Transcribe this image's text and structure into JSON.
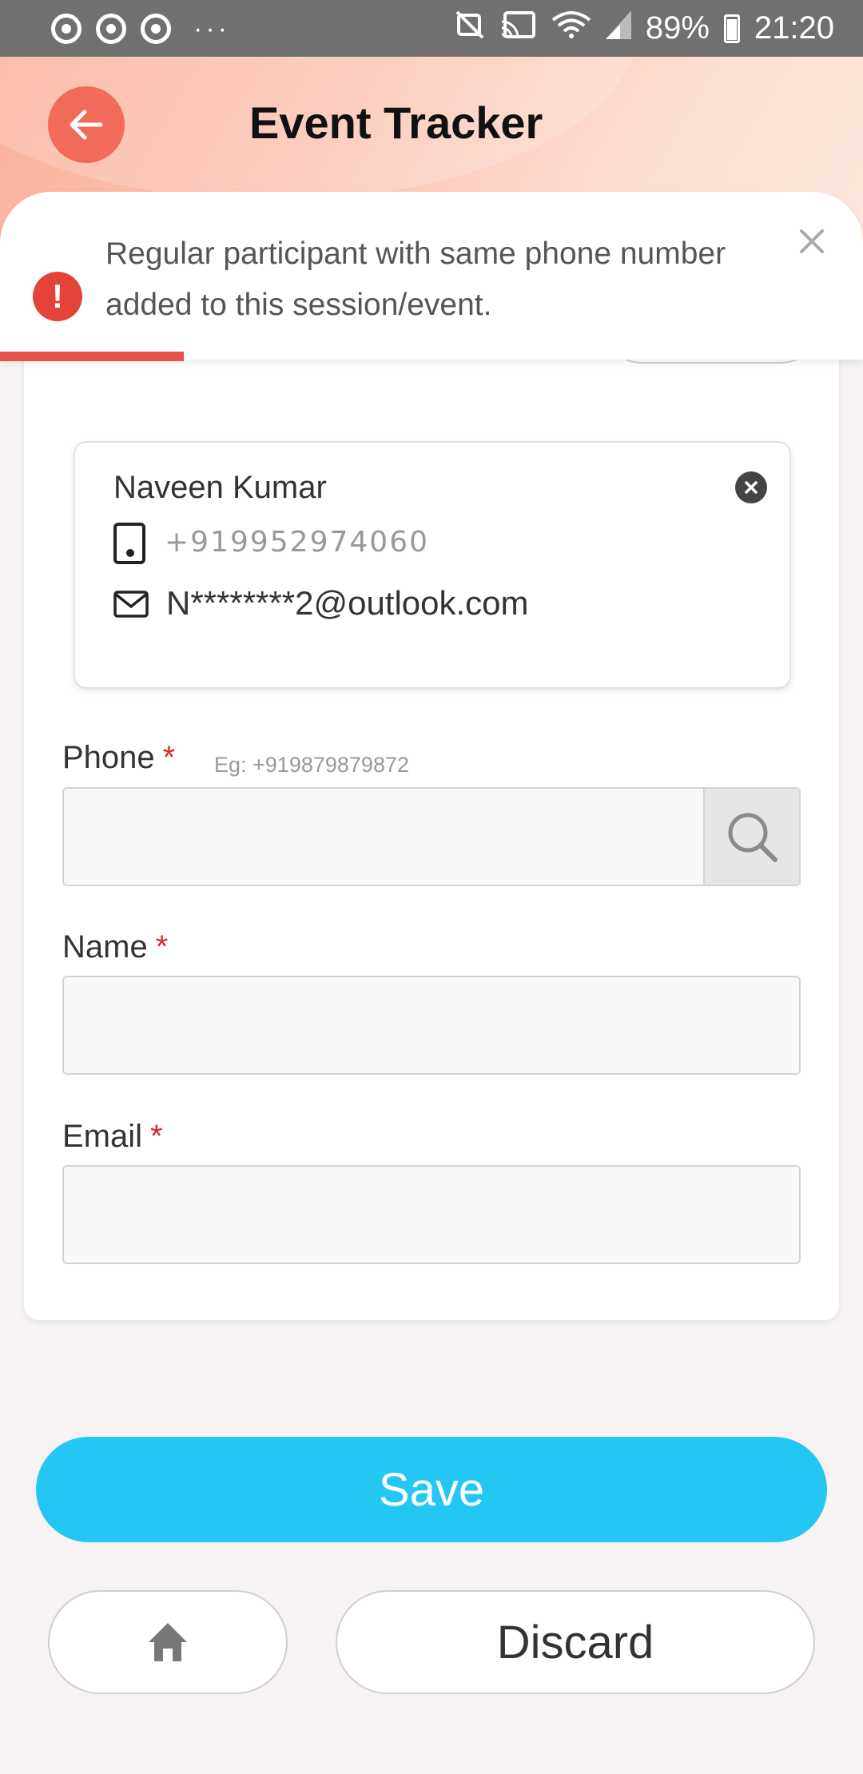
{
  "status_bar": {
    "battery": "89%",
    "time": "21:20",
    "left_icons": [
      "chrome-icon",
      "chrome-icon",
      "chrome-icon",
      "more-dots-icon"
    ],
    "right_icons": [
      "mute-icon",
      "cast-icon",
      "wifi-icon",
      "signal-icon",
      "battery-icon"
    ]
  },
  "header": {
    "title": "Event Tracker",
    "back_icon": "arrow-left-icon",
    "accent": "#f26b5a"
  },
  "toast": {
    "message": "Regular participant with same phone number added to this session/event.",
    "icon": "error-icon",
    "icon_symbol": "!",
    "close_icon": "close-icon",
    "error_color": "#e4433a"
  },
  "participant": {
    "name": "Naveen Kumar",
    "phone": "+919952974060",
    "email": "N********2@outlook.com"
  },
  "form": {
    "phone": {
      "label": "Phone",
      "required_mark": "*",
      "hint": "Eg: +919879879872",
      "value": ""
    },
    "name": {
      "label": "Name",
      "required_mark": "*",
      "value": ""
    },
    "email": {
      "label": "Email",
      "required_mark": "*",
      "value": ""
    }
  },
  "actions": {
    "save_label": "Save",
    "discard_label": "Discard",
    "save_color": "#24c7f4",
    "home_icon": "home-icon"
  }
}
